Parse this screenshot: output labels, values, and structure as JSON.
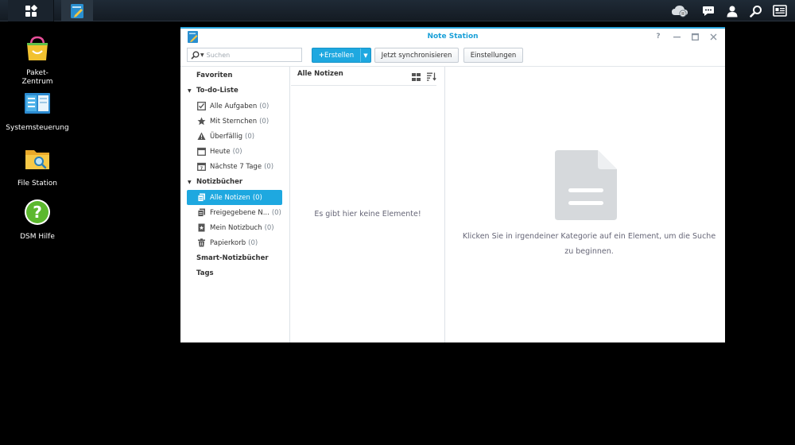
{
  "taskbar": {
    "main_menu_icon": "grid-icon",
    "open_app_icon": "note-station-icon",
    "right_icons": [
      "cloud-sync-icon",
      "chat-icon",
      "user-icon",
      "search-icon",
      "widgets-icon"
    ]
  },
  "desktop": {
    "icons": [
      {
        "label": "Paket-\nZentrum",
        "icon": "package-center-icon"
      },
      {
        "label": "Systemsteuerung",
        "icon": "control-panel-icon"
      },
      {
        "label": "File Station",
        "icon": "file-station-icon"
      },
      {
        "label": "DSM Hilfe",
        "icon": "help-icon"
      }
    ]
  },
  "window": {
    "title": "Note Station",
    "controls": [
      "help-icon",
      "minimize-icon",
      "maximize-icon",
      "close-icon"
    ]
  },
  "toolbar": {
    "search_placeholder": "Suchen",
    "create_label": "Erstellen",
    "sync_label": "Jetzt synchronisieren",
    "settings_label": "Einstellungen"
  },
  "sidebar": {
    "favorites": "Favoriten",
    "todo_section": "To-do-Liste",
    "todo_items": [
      {
        "label": "Alle Aufgaben",
        "count": "(0)",
        "icon": "checkbox-icon"
      },
      {
        "label": "Mit Sternchen",
        "count": "(0)",
        "icon": "star-icon"
      },
      {
        "label": "Überfällig",
        "count": "(0)",
        "icon": "warning-icon"
      },
      {
        "label": "Heute",
        "count": "(0)",
        "icon": "calendar-icon"
      },
      {
        "label": "Nächste 7 Tage",
        "count": "(0)",
        "icon": "calendar-week-icon"
      }
    ],
    "notebooks_section": "Notizbücher",
    "notebook_items": [
      {
        "label": "Alle Notizen",
        "count": "(0)",
        "icon": "notes-icon"
      },
      {
        "label": "Freigegebene N...",
        "count": "(0)",
        "icon": "shared-notes-icon"
      },
      {
        "label": "Mein Notizbuch",
        "count": "(0)",
        "icon": "notebook-icon"
      },
      {
        "label": "Papierkorb",
        "count": "(0)",
        "icon": "trash-icon"
      }
    ],
    "smart_notebooks": "Smart-Notizbücher",
    "tags": "Tags"
  },
  "notelist": {
    "title": "Alle Notizen",
    "empty_text": "Es gibt hier keine Elemente!",
    "tool_icons": [
      "grid-view-icon",
      "sort-icon"
    ]
  },
  "detail": {
    "placeholder_icon": "document-icon",
    "message_line1": "Klicken Sie in irgendeiner Kategorie auf ein Element, um die Suche",
    "message_line2": "zu beginnen."
  },
  "colors": {
    "accent": "#1ea8e0",
    "title": "#1aa0d8",
    "desktop": "#000000"
  }
}
